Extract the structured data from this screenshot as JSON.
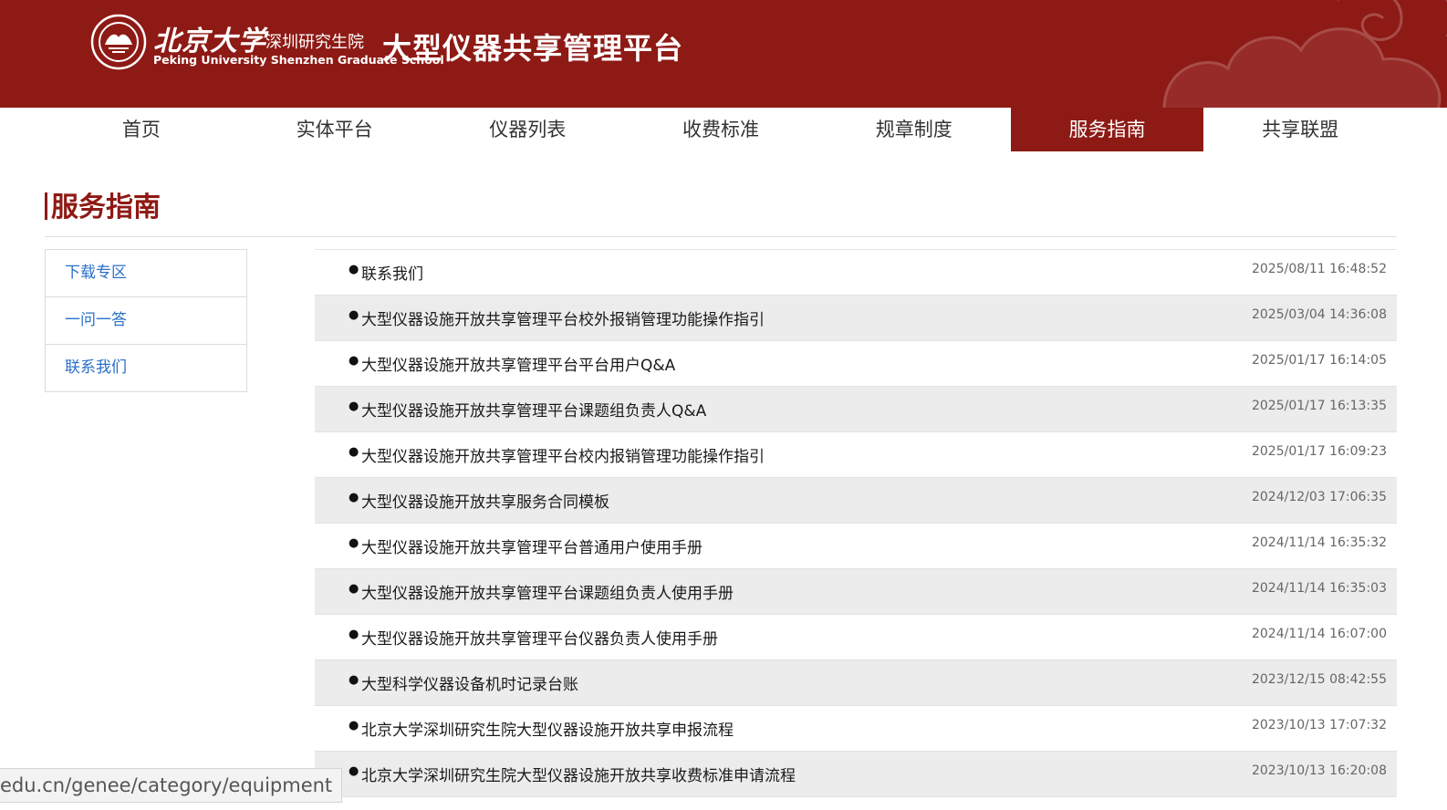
{
  "header": {
    "logo_cn": "北京大学",
    "logo_cn_sub": "深圳研究生院",
    "logo_en": "Peking University Shenzhen Graduate School",
    "site_title": "大型仪器共享管理平台"
  },
  "nav": {
    "items": [
      {
        "label": "首页"
      },
      {
        "label": "实体平台"
      },
      {
        "label": "仪器列表"
      },
      {
        "label": "收费标准"
      },
      {
        "label": "规章制度"
      },
      {
        "label": "服务指南"
      },
      {
        "label": "共享联盟"
      }
    ],
    "active": "服务指南"
  },
  "page": {
    "section_title": "服务指南"
  },
  "sidebar": {
    "items": [
      {
        "label": "下载专区"
      },
      {
        "label": "一问一答"
      },
      {
        "label": "联系我们"
      }
    ]
  },
  "list": {
    "bullet": "●",
    "rows": [
      {
        "title": "联系我们",
        "date": "2025/08/11 16:48:52"
      },
      {
        "title": "大型仪器设施开放共享管理平台校外报销管理功能操作指引",
        "date": "2025/03/04 14:36:08"
      },
      {
        "title": "大型仪器设施开放共享管理平台平台用户Q&A",
        "date": "2025/01/17 16:14:05"
      },
      {
        "title": "大型仪器设施开放共享管理平台课题组负责人Q&A",
        "date": "2025/01/17 16:13:35"
      },
      {
        "title": "大型仪器设施开放共享管理平台校内报销管理功能操作指引",
        "date": "2025/01/17 16:09:23"
      },
      {
        "title": "大型仪器设施开放共享服务合同模板",
        "date": "2024/12/03 17:06:35"
      },
      {
        "title": "大型仪器设施开放共享管理平台普通用户使用手册",
        "date": "2024/11/14 16:35:32"
      },
      {
        "title": "大型仪器设施开放共享管理平台课题组负责人使用手册",
        "date": "2024/11/14 16:35:03"
      },
      {
        "title": "大型仪器设施开放共享管理平台仪器负责人使用手册",
        "date": "2024/11/14 16:07:00"
      },
      {
        "title": "大型科学仪器设备机时记录台账",
        "date": "2023/12/15 08:42:55"
      },
      {
        "title": "北京大学深圳研究生院大型仪器设施开放共享申报流程",
        "date": "2023/10/13 17:07:32"
      },
      {
        "title": "北京大学深圳研究生院大型仪器设施开放共享收费标准申请流程",
        "date": "2023/10/13 16:20:08"
      }
    ]
  },
  "statusbar": {
    "url": "edu.cn/genee/category/equipment"
  },
  "colors": {
    "brand": "#8e1a15",
    "link": "#2a6fc9",
    "row_alt": "#ececec"
  }
}
